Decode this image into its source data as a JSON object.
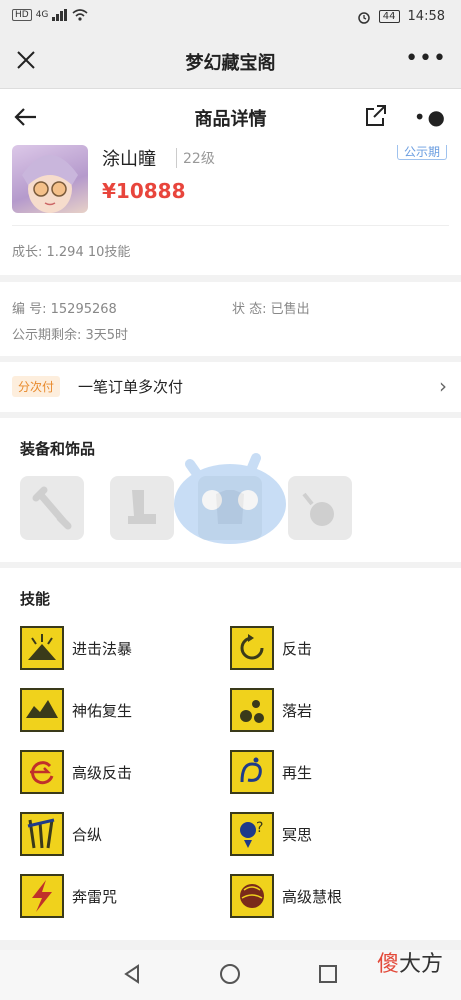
{
  "status_bar": {
    "network": "4G",
    "time": "14:58",
    "battery": "44"
  },
  "wechat_bar": {
    "title": "梦幻藏宝阁",
    "close_icon": "close-icon",
    "more_icon": "more-icon"
  },
  "app_bar": {
    "title": "商品详情"
  },
  "product": {
    "name": "涂山瞳",
    "level": "22级",
    "price": "¥10888",
    "tag": "公示期",
    "growth": "成长: 1.294 10技能"
  },
  "info": {
    "serial": "编 号: 15295268",
    "status": "状 态: 已售出",
    "public_remaining": "公示期剩余: 3天5时"
  },
  "payment": {
    "tag": "分次付",
    "text": "一笔订单多次付"
  },
  "equipment": {
    "title": "装备和饰品",
    "slots": [
      "weapon-icon",
      "boots-icon",
      "armor-icon",
      "accessory-icon"
    ]
  },
  "skills": {
    "title": "技能",
    "items": [
      {
        "label": "进击法暴"
      },
      {
        "label": "反击"
      },
      {
        "label": "神佑复生"
      },
      {
        "label": "落岩"
      },
      {
        "label": "高级反击"
      },
      {
        "label": "再生"
      },
      {
        "label": "合纵"
      },
      {
        "label": "冥思"
      },
      {
        "label": "奔雷咒"
      },
      {
        "label": "高级慧根"
      }
    ]
  },
  "watermark": {
    "left": "傻",
    "right": "大方"
  },
  "colors": {
    "price": "#e8453c",
    "skill_icon": "#f0d21c",
    "pay_tag": "#e88a2c"
  }
}
